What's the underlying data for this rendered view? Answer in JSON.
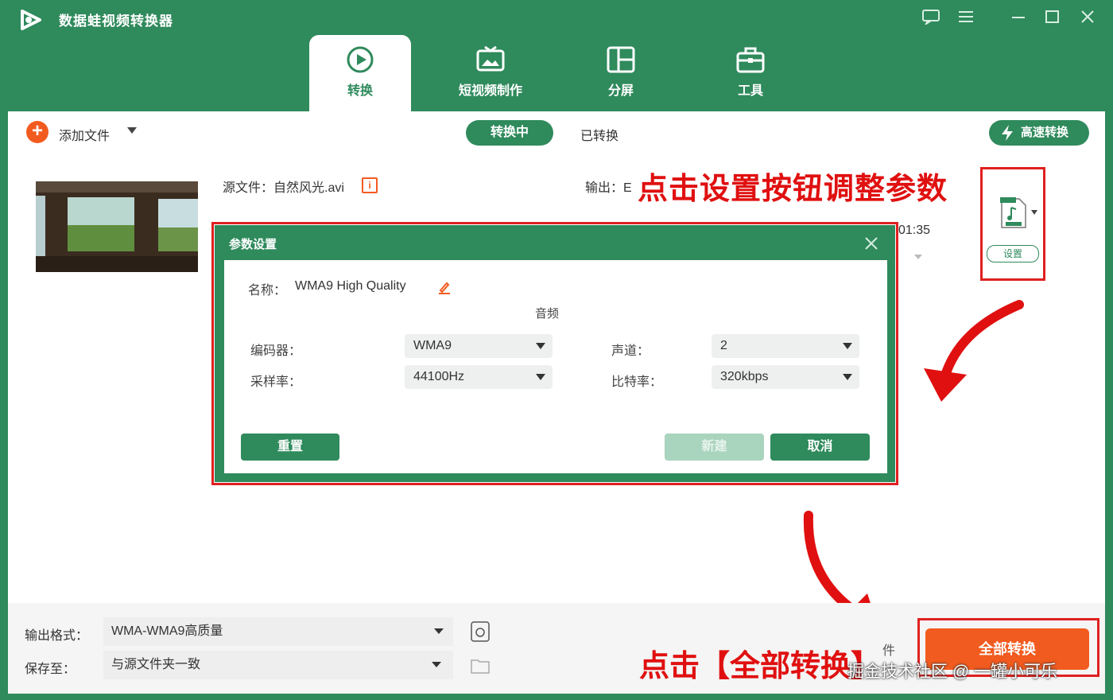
{
  "app": {
    "title": "数据蛙视频转换器"
  },
  "main_tabs": [
    {
      "label": "转换",
      "icon": "convert-icon",
      "active": true
    },
    {
      "label": "短视频制作",
      "icon": "tv-icon",
      "active": false
    },
    {
      "label": "分屏",
      "icon": "split-screen-icon",
      "active": false
    },
    {
      "label": "工具",
      "icon": "toolbox-icon",
      "active": false
    }
  ],
  "toolbar": {
    "add_file_label": "添加文件",
    "status_tabs": [
      {
        "label": "转换中",
        "active": true
      },
      {
        "label": "已转换",
        "active": false
      }
    ],
    "fast_convert_label": "高速转换"
  },
  "file_item": {
    "source_label": "源文件：自然风光.avi",
    "output_label": "输出：E",
    "duration_partial": "01:35",
    "settings_label": "设置",
    "format_icon": "audio-file-icon"
  },
  "dialog": {
    "title": "参数设置",
    "name_label": "名称：",
    "name_value": "WMA9 High Quality",
    "section_label": "音频",
    "fields": {
      "encoder_label": "编码器：",
      "encoder_value": "WMA9",
      "channel_label": "声道：",
      "channel_value": "2",
      "sample_rate_label": "采样率：",
      "sample_rate_value": "44100Hz",
      "bitrate_label": "比特率：",
      "bitrate_value": "320kbps"
    },
    "reset_label": "重置",
    "create_label": "新建",
    "cancel_label": "取消"
  },
  "bottom": {
    "output_format_label": "输出格式：",
    "output_format_value": "WMA-WMA9高质量",
    "save_to_label": "保存至：",
    "save_to_value": "与源文件夹一致",
    "merge_label_partial": "件",
    "convert_all_label": "全部转换"
  },
  "annotations": {
    "top": "点击设置按钮调整参数",
    "bottom": "点击【全部转换】",
    "watermark": "掘金技术社区 @ 一罐小可乐"
  },
  "colors": {
    "brand_green": "#2f8a5c",
    "accent_orange": "#f25b1f",
    "annotation_red": "#e01010"
  }
}
